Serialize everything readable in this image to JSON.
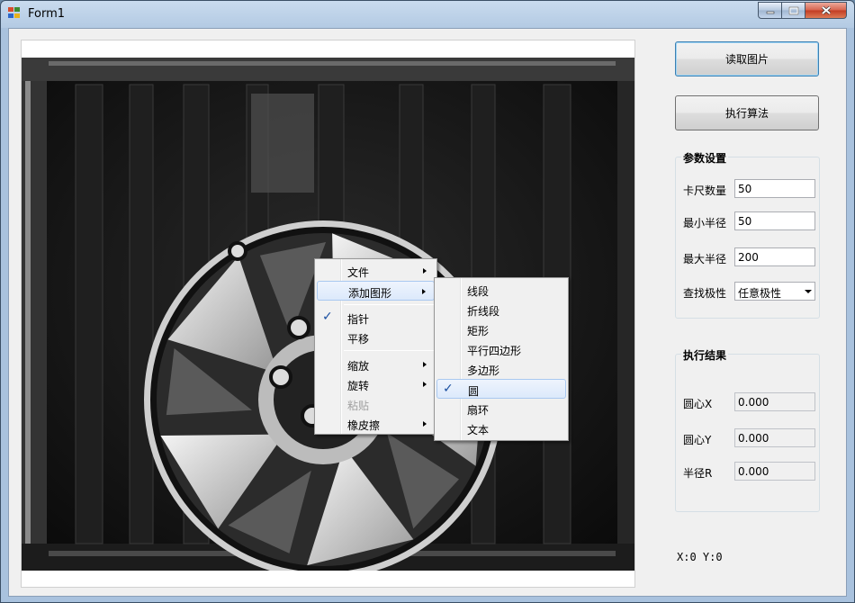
{
  "window": {
    "title": "Form1"
  },
  "picture": {
    "description_icon": "wheel-rim-image"
  },
  "buttons": {
    "read_image": "读取图片",
    "run_algorithm": "执行算法"
  },
  "params": {
    "group_title": "参数设置",
    "caliper_count_label": "卡尺数量",
    "caliper_count": "50",
    "min_radius_label": "最小半径",
    "min_radius": "50",
    "max_radius_label": "最大半径",
    "max_radius": "200",
    "polarity_label": "查找极性",
    "polarity": "任意极性"
  },
  "results": {
    "group_title": "执行结果",
    "center_x_label": "圆心X",
    "center_x": "0.000",
    "center_y_label": "圆心Y",
    "center_y": "0.000",
    "radius_label": "半径R",
    "radius": "0.000"
  },
  "status": {
    "coords": "X:0 Y:0"
  },
  "context_menu": {
    "file": "文件",
    "add_shape": "添加图形",
    "pointer": "指针",
    "pan": "平移",
    "zoom": "缩放",
    "rotate": "旋转",
    "paste": "粘贴",
    "eraser": "橡皮擦"
  },
  "shape_menu": {
    "line": "线段",
    "polyline": "折线段",
    "rectangle": "矩形",
    "parallelogram": "平行四边形",
    "polygon": "多边形",
    "circle": "圆",
    "annulus_sector": "扇环",
    "text": "文本"
  }
}
